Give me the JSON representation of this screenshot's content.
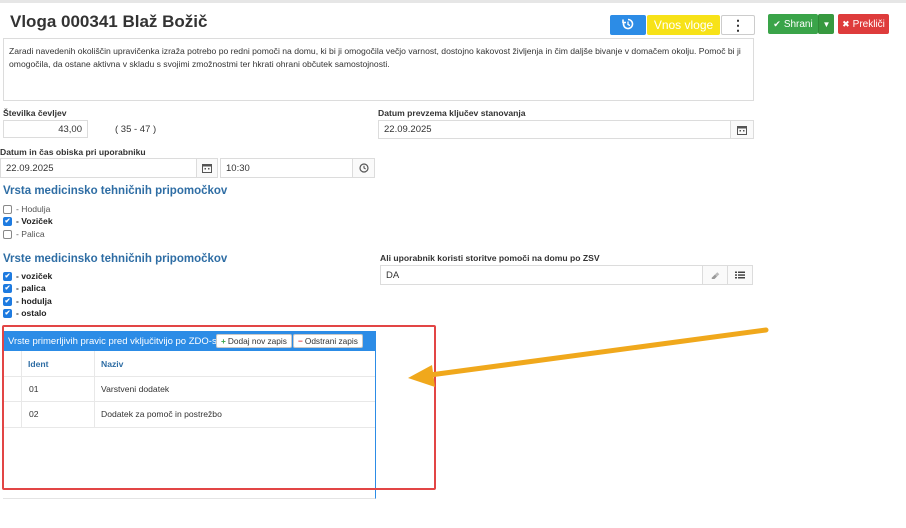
{
  "header": {
    "title": "Vloga 000341 Blaž Božič",
    "vnos_label": "Vnos vloge",
    "more_label": "⋮",
    "save_label": "Shrani",
    "cancel_label": "Prekliči"
  },
  "description": "Zaradi navedenih okoliščin upravičenka izraža potrebo po redni pomoči na domu, ki bi ji omogočila večjo varnost, dostojno kakovost življenja in čim daljše bivanje v domačem okolju. Pomoč bi ji omogočila, da ostane aktivna v skladu s svojimi zmožnostmi ter hkrati ohrani občutek samostojnosti.",
  "fields": {
    "stevilka_label": "Številka čevljev",
    "stevilka_value": "43,00",
    "stevilka_range": "( 35 - 47 )",
    "prevzem_label": "Datum prevzema ključev stanovanja",
    "prevzem_value": "22.09.2025",
    "obisk_label": "Datum in čas obiska pri uporabniku",
    "obisk_date": "22.09.2025",
    "obisk_time": "10:30",
    "zsv_label": "Ali uporabnik koristi storitve pomoči na domu po ZSV",
    "zsv_value": "DA"
  },
  "section1": {
    "title": "Vrsta medicinsko tehničnih pripomočkov",
    "items": [
      {
        "label": "- Hodulja",
        "checked": false
      },
      {
        "label": "- Voziček",
        "checked": true
      },
      {
        "label": "- Palica",
        "checked": false
      }
    ]
  },
  "section2": {
    "title": "Vrste medicinsko tehničnih pripomočkov",
    "items": [
      {
        "label": "- voziček",
        "checked": true
      },
      {
        "label": "- palica",
        "checked": true
      },
      {
        "label": "- hodulja",
        "checked": true
      },
      {
        "label": "- ostalo",
        "checked": true
      }
    ]
  },
  "grid": {
    "title": "Vrste primerljivih pravic pred vključitvijo po ZDO-sk",
    "add_label": "Dodaj nov zapis",
    "remove_label": "Odstrani zapis",
    "columns": [
      "Ident",
      "Naziv"
    ],
    "rows": [
      [
        "01",
        "Varstveni dodatek"
      ],
      [
        "02",
        "Dodatek za pomoč in postrežbo"
      ]
    ]
  },
  "colors": {
    "primary": "#2c8ce6",
    "warning": "#f7e218",
    "success": "#3aa449",
    "danger": "#de3c3c",
    "annotation_arrow": "#f0a81c",
    "annotation_box": "#e24545"
  }
}
